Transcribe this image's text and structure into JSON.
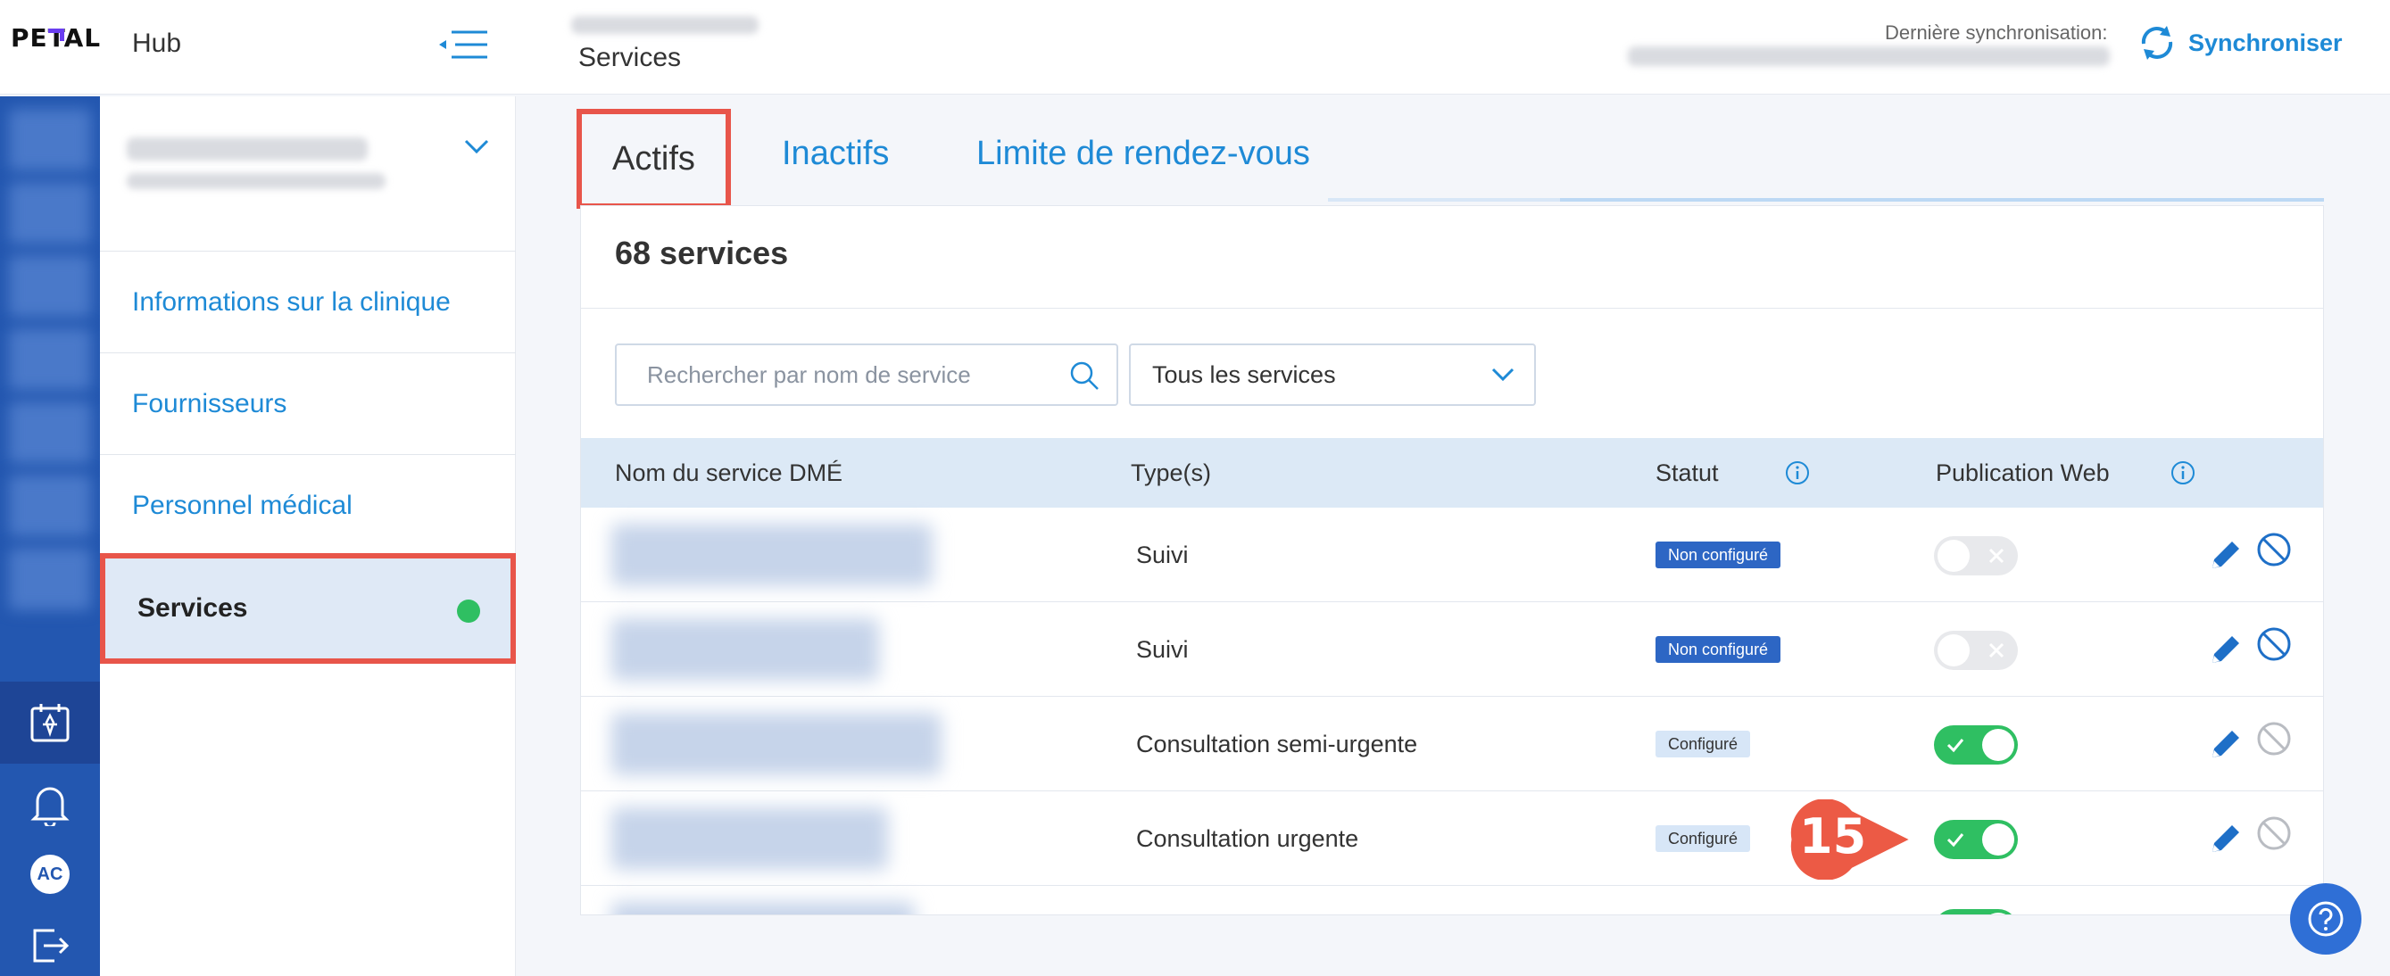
{
  "header": {
    "logo": "PETAL",
    "hub_label": "Hub",
    "page_title": "Services",
    "sync_label": "Dernière synchronisation:",
    "sync_button": "Synchroniser"
  },
  "rail": {
    "avatar_initials": "AC"
  },
  "sidebar": {
    "items": [
      {
        "label": "Informations sur la clinique"
      },
      {
        "label": "Fournisseurs"
      },
      {
        "label": "Personnel médical"
      },
      {
        "label": "Services"
      }
    ]
  },
  "tabs": [
    {
      "label": "Actifs"
    },
    {
      "label": "Inactifs"
    },
    {
      "label": "Limite de rendez-vous"
    }
  ],
  "card": {
    "title": "68 services",
    "search_placeholder": "Rechercher par nom de service",
    "filter_value": "Tous les services"
  },
  "table": {
    "headers": {
      "name": "Nom du service DMÉ",
      "types": "Type(s)",
      "status": "Statut",
      "web": "Publication Web"
    },
    "rows": [
      {
        "type": "Suivi",
        "status": "Non configuré",
        "web_published": false
      },
      {
        "type": "Suivi",
        "status": "Non configuré",
        "web_published": false
      },
      {
        "type": "Consultation semi-urgente",
        "status": "Configuré",
        "web_published": true
      },
      {
        "type": "Consultation urgente",
        "status": "Configuré",
        "web_published": true
      }
    ]
  },
  "annotation": {
    "step_number": "15"
  },
  "colors": {
    "accent": "#1e8ad6",
    "rail": "#2357b0",
    "highlight": "#e8554a",
    "toggle_on": "#2fbf62"
  }
}
